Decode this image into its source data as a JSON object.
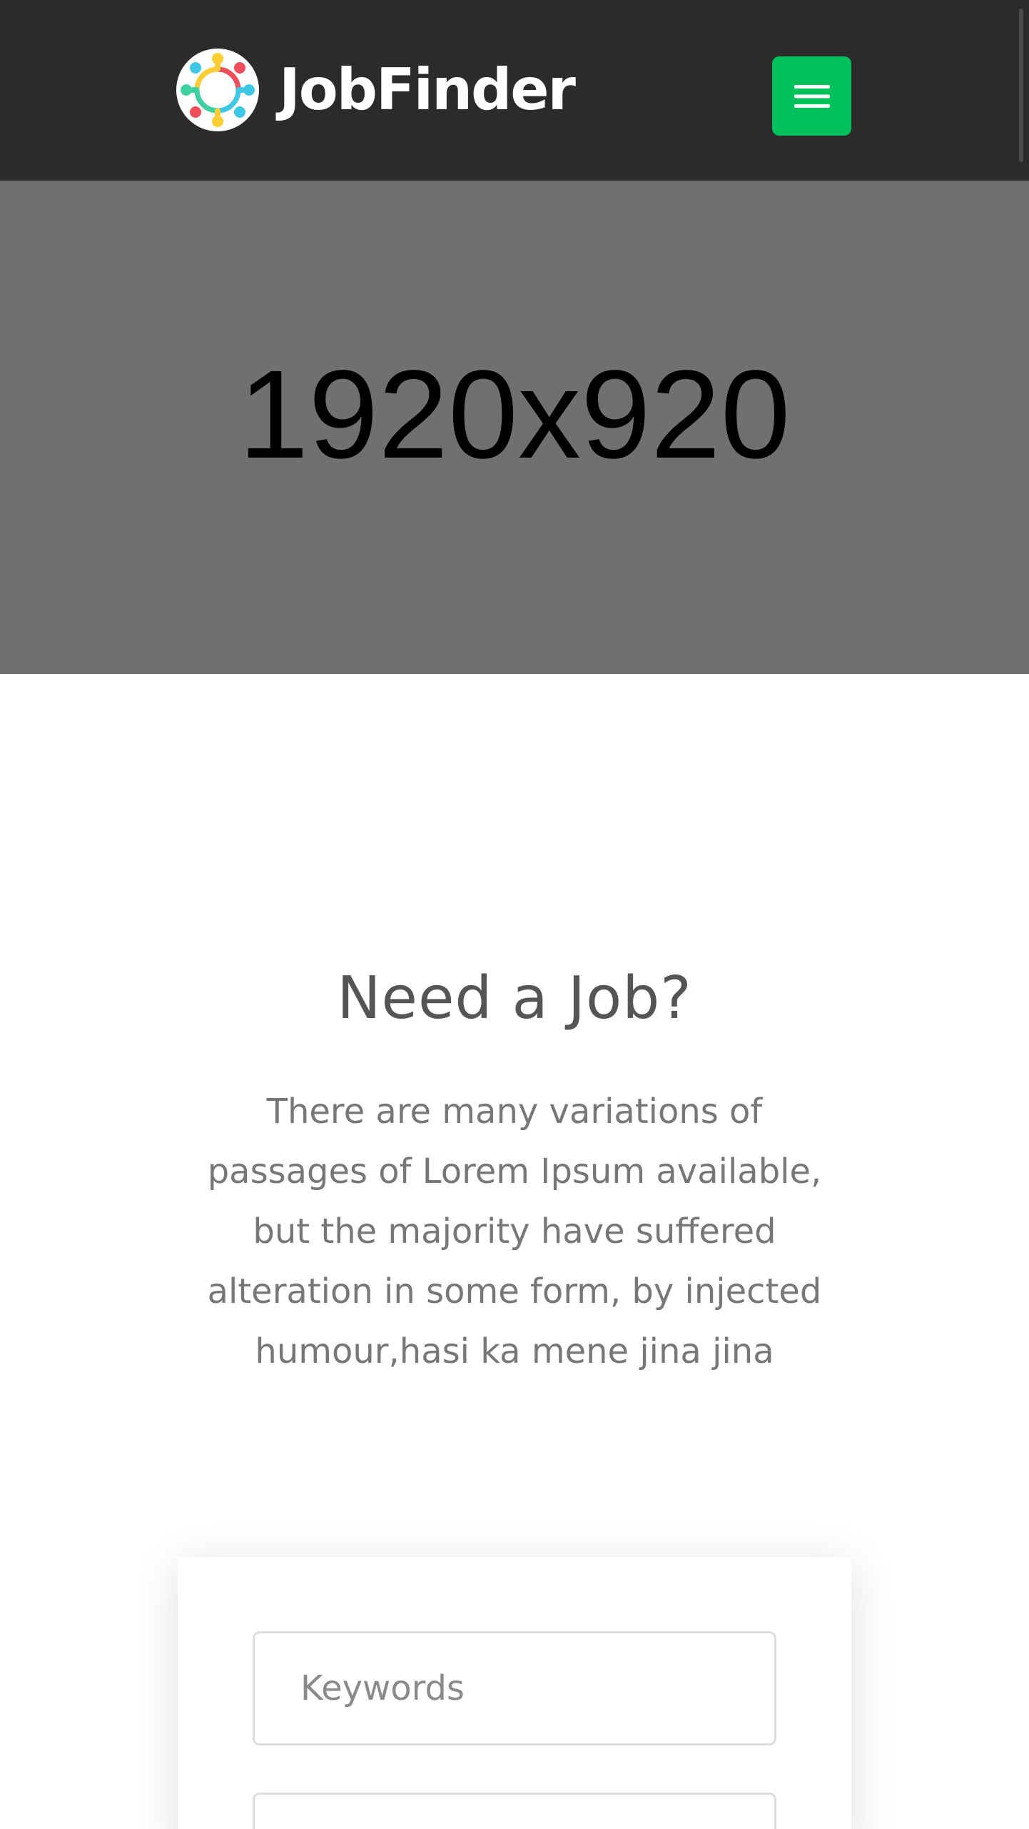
{
  "header": {
    "brand_name": "JobFinder",
    "logo_icon": "people-circle-logo-icon",
    "menu_icon": "hamburger-menu-icon",
    "background_color": "#2b2b2b",
    "accent_color": "#00c05a"
  },
  "hero": {
    "placeholder_label": "1920x920",
    "background_color": "#707070"
  },
  "intro": {
    "title": "Need a Job?",
    "description": "There are many variations of passages of Lorem Ipsum available, but the majority have suffered alteration in some form, by injected humour,hasi ka mene jina jina"
  },
  "search": {
    "keywords_placeholder": "Keywords",
    "keywords_value": "",
    "second_placeholder": ""
  }
}
